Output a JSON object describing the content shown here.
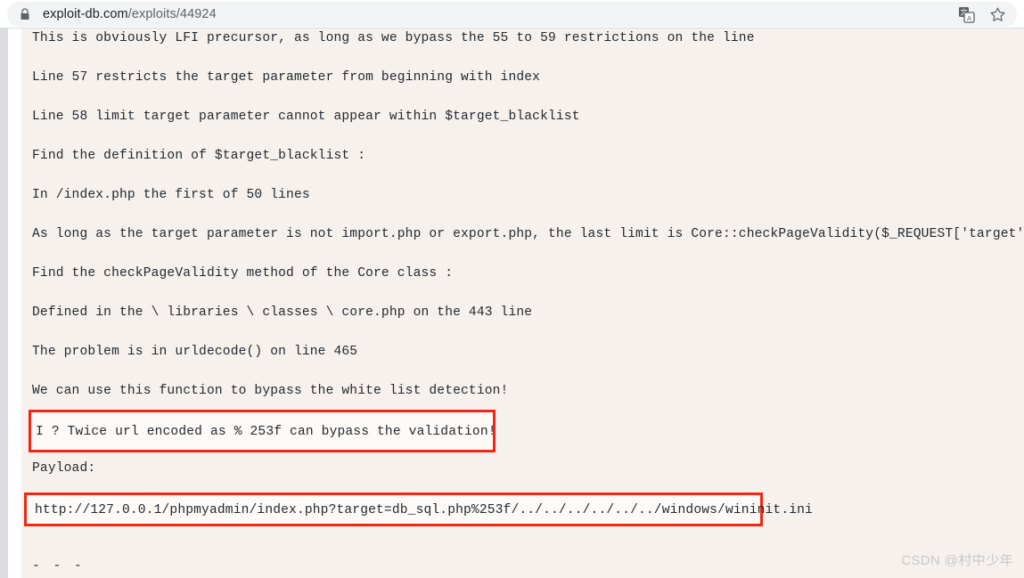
{
  "browser": {
    "lock_icon": "lock-icon",
    "url_domain": "exploit-db.com",
    "url_path": "/exploits/44924",
    "translate_icon": "translate-icon",
    "bookmark_icon": "star-icon"
  },
  "page": {
    "lines": [
      "This is obviously LFI precursor, as long as we bypass the 55 to 59 restrictions on the line",
      "Line 57 restricts the target parameter from beginning with index",
      "Line 58 limit target parameter cannot appear within $target_blacklist",
      "Find the definition of $target_blacklist :",
      "In /index.php the first of 50 lines",
      "As long as the target parameter is not import.php or export.php, the last limit is Core::checkPageValidity($_REQUEST['target'])",
      "Find the checkPageValidity method of the Core class :",
      "Defined in the \\ libraries \\ classes \\ core.php on the 443 line",
      "The problem is in urldecode() on line 465",
      "We can use this function to bypass the white list detection!"
    ],
    "highlight_note": "I ? Twice url encoded as % 253f can bypass the validation!",
    "payload_label": "Payload:",
    "payload_url": "http://127.0.0.1/phpmyadmin/index.php?target=db_sql.php%253f/../../../../../../windows/wininit.ini",
    "footer_separator": "- - -",
    "watermark": "CSDN @村中少年"
  },
  "colors": {
    "highlight_border": "#f22613",
    "page_background": "#f6f1ed",
    "text": "#24292e",
    "omnibox_background": "#f1f3f4"
  }
}
